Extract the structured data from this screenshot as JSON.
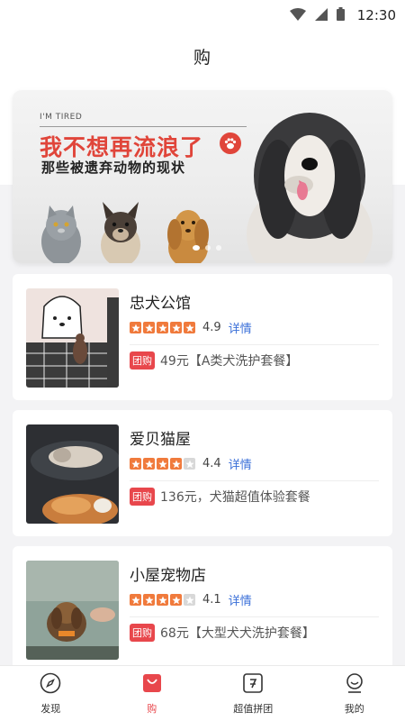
{
  "status_bar": {
    "time": "12:30"
  },
  "header": {
    "title": "购"
  },
  "banner": {
    "tag": "I'M TIRED",
    "headline": "我不想再流浪了",
    "subline": "那些被遗弃动物的现状",
    "accent_color": "#e0453a"
  },
  "stores": [
    {
      "name": "忠犬公馆",
      "rating": 4.9,
      "stars_filled": 5,
      "score": "4.9",
      "detail": "详情",
      "badge": "团购",
      "deal": "49元【A类犬洗护套餐】"
    },
    {
      "name": "爱贝猫屋",
      "rating": 4.4,
      "stars_filled": 4,
      "score": "4.4",
      "detail": "详情",
      "badge": "团购",
      "deal": "136元，犬猫超值体验套餐"
    },
    {
      "name": "小屋宠物店",
      "rating": 4.1,
      "stars_filled": 4,
      "score": "4.1",
      "detail": "详情",
      "badge": "团购",
      "deal": "68元【大型犬犬洗护套餐】"
    }
  ],
  "bottom_nav": [
    {
      "label": "发现",
      "icon": "compass-icon",
      "active": false
    },
    {
      "label": "购",
      "icon": "shopping-bag-icon",
      "active": true
    },
    {
      "label": "超值拼团",
      "icon": "group-deal-icon",
      "active": false
    },
    {
      "label": "我的",
      "icon": "user-icon",
      "active": false
    }
  ],
  "colors": {
    "accent": "#e8474c",
    "star": "#f07a3c",
    "link": "#3a6fd8"
  }
}
